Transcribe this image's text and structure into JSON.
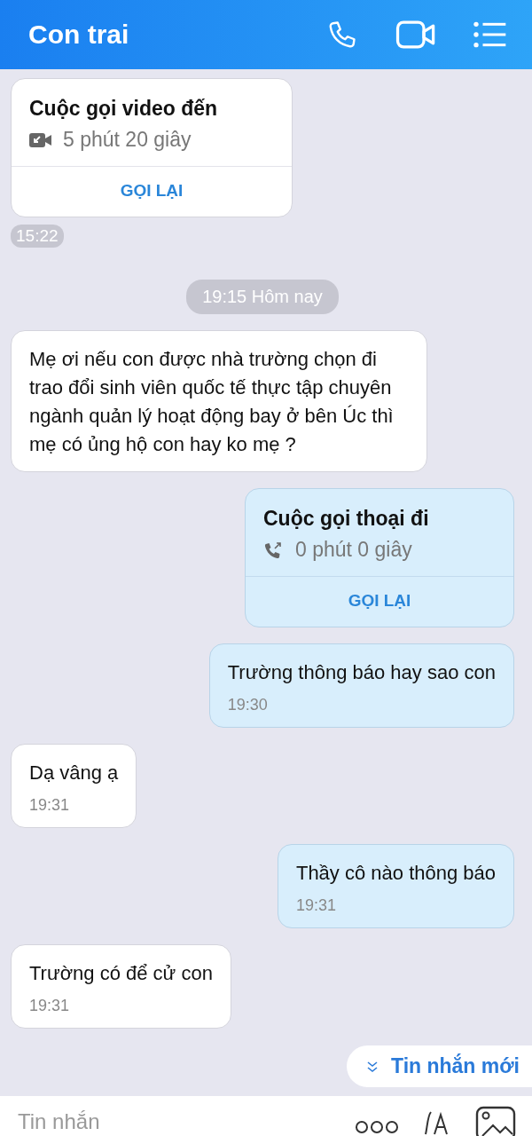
{
  "header": {
    "title": "Con trai"
  },
  "messages": [
    {
      "kind": "video_call",
      "outgoing": false,
      "title": "Cuộc gọi video đến",
      "duration": "5 phút 20 giây",
      "action": "GỌI LẠI",
      "time": "15:22"
    },
    {
      "kind": "divider",
      "text": "19:15 Hôm nay"
    },
    {
      "kind": "text",
      "outgoing": false,
      "text": "Mẹ ơi nếu con được nhà trường chọn đi trao đổi sinh viên quốc tế thực tập chuyên ngành quản lý hoạt động bay ở bên Úc thì mẹ có ủng hộ con hay ko mẹ ?"
    },
    {
      "kind": "voice_call",
      "outgoing": true,
      "title": "Cuộc gọi thoại đi",
      "duration": "0 phút 0 giây",
      "action": "GỌI LẠI"
    },
    {
      "kind": "text",
      "outgoing": true,
      "text": "Trường thông báo hay sao con",
      "time": "19:30"
    },
    {
      "kind": "text",
      "outgoing": false,
      "text": "Dạ vâng ạ",
      "time": "19:31"
    },
    {
      "kind": "text",
      "outgoing": true,
      "text": "Thầy cô nào thông báo",
      "time": "19:31"
    },
    {
      "kind": "text",
      "outgoing": false,
      "text": "Trường có để cử con",
      "time": "19:31"
    }
  ],
  "new_messages": {
    "label": "Tin nhắn mới"
  },
  "composer": {
    "placeholder": "Tin nhắn"
  }
}
